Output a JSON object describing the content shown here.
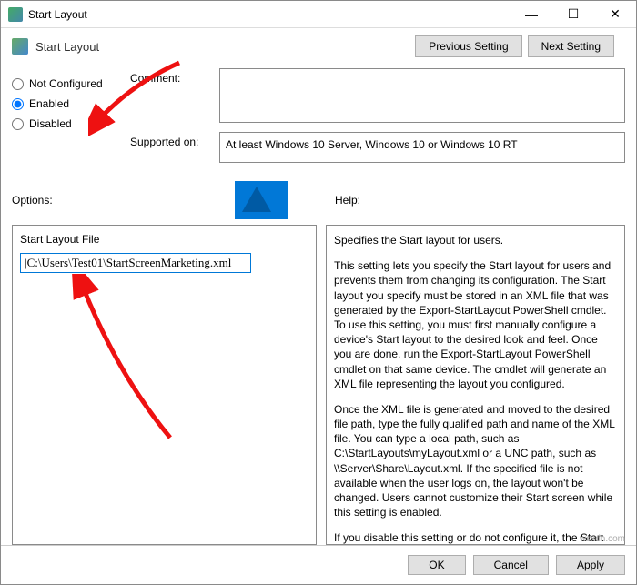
{
  "titlebar": {
    "title": "Start Layout"
  },
  "header": {
    "title": "Start Layout",
    "prev": "Previous Setting",
    "next": "Next Setting"
  },
  "radios": {
    "not_configured": "Not Configured",
    "enabled": "Enabled",
    "disabled": "Disabled",
    "selected": "enabled"
  },
  "labels": {
    "comment": "Comment:",
    "supported": "Supported on:",
    "options": "Options:",
    "help": "Help:",
    "file_label": "Start Layout File"
  },
  "values": {
    "comment": "",
    "supported": "At least Windows 10 Server, Windows 10 or Windows 10 RT",
    "path": "|C:\\Users\\Test01\\StartScreenMarketing.xml"
  },
  "help": {
    "p1": "Specifies the Start layout for users.",
    "p2": "This setting lets you specify the Start layout for users and prevents them from changing its configuration. The Start layout you specify must be stored in an XML file that was generated by the Export-StartLayout PowerShell cmdlet.",
    "p3": "To use this setting, you must first manually configure a device's Start layout to the desired look and feel. Once you are done, run the Export-StartLayout PowerShell cmdlet on that same device. The cmdlet will generate an XML file representing the layout you configured.",
    "p4": "Once the XML file is generated and moved to the desired file path, type the fully qualified path and name of the XML file. You can type a local path, such as C:\\StartLayouts\\myLayout.xml or a UNC path, such as \\\\Server\\Share\\Layout.xml. If the specified file is not available when the user logs on, the layout won't be changed. Users cannot customize their Start screen while this setting is enabled.",
    "p5": "If you disable this setting or do not configure it, the Start screen"
  },
  "buttons": {
    "ok": "OK",
    "cancel": "Cancel",
    "apply": "Apply"
  },
  "watermark": "wsxdn.com"
}
